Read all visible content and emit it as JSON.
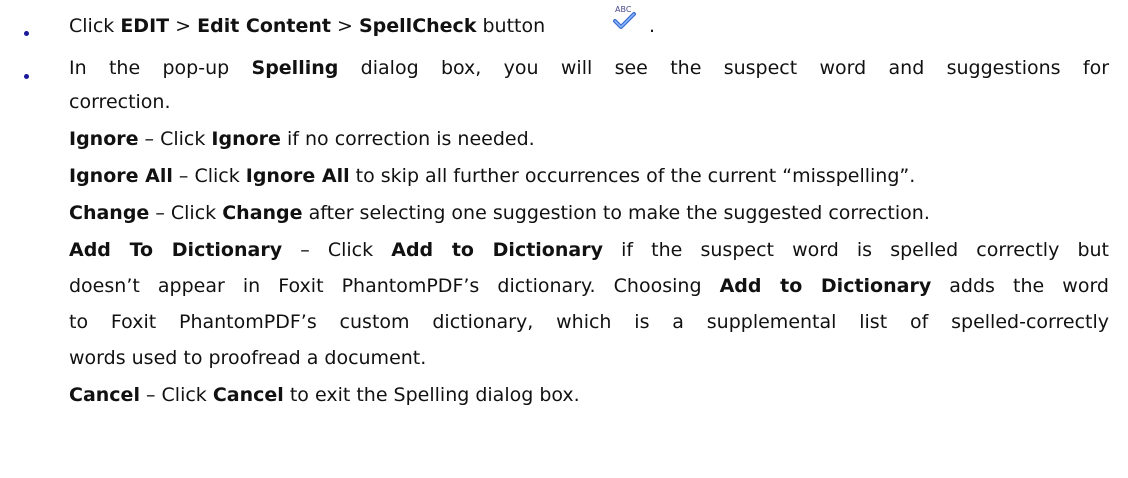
{
  "step1": {
    "click": "Click ",
    "edit": "EDIT",
    "sep1": " > ",
    "edit_content": "Edit Content",
    "sep2": " > ",
    "spellcheck": "SpellCheck",
    "button": " button",
    "icon_text": "ABC",
    "icon": "spellcheck-icon",
    "end": "."
  },
  "step2": {
    "line1_a": "In the pop-up ",
    "line1_b": "Spelling",
    "line1_c": " dialog box, you will see the suspect word and suggestions for",
    "line2": "correction."
  },
  "items": {
    "ignore": {
      "term": "Ignore",
      "dash": " – Click ",
      "term2": "Ignore",
      "rest": " if no correction is needed."
    },
    "ignore_all": {
      "term": "Ignore All",
      "dash": " – Click ",
      "term2": "Ignore All",
      "rest": " to skip all further occurrences of the current “misspelling”."
    },
    "change": {
      "term": "Change",
      "dash": " – Click ",
      "term2": "Change",
      "rest": " after selecting one suggestion to make the suggested correction."
    },
    "add": {
      "term": "Add To Dictionary",
      "dash": " – Click ",
      "term2": "Add to Dictionary",
      "rest1": " if the suspect word is spelled correctly but",
      "line2_a": "doesn’t appear in Foxit PhantomPDF’s dictionary. Choosing ",
      "line2_b": "Add to Dictionary",
      "line2_c": " adds the word",
      "line3": "to Foxit PhantomPDF’s custom dictionary, which is a supplemental list of spelled-correctly",
      "line4": "words used to proofread a document."
    },
    "cancel": {
      "term": "Cancel",
      "dash": " – Click ",
      "term2": "Cancel",
      "rest": " to exit the Spelling dialog box."
    }
  }
}
